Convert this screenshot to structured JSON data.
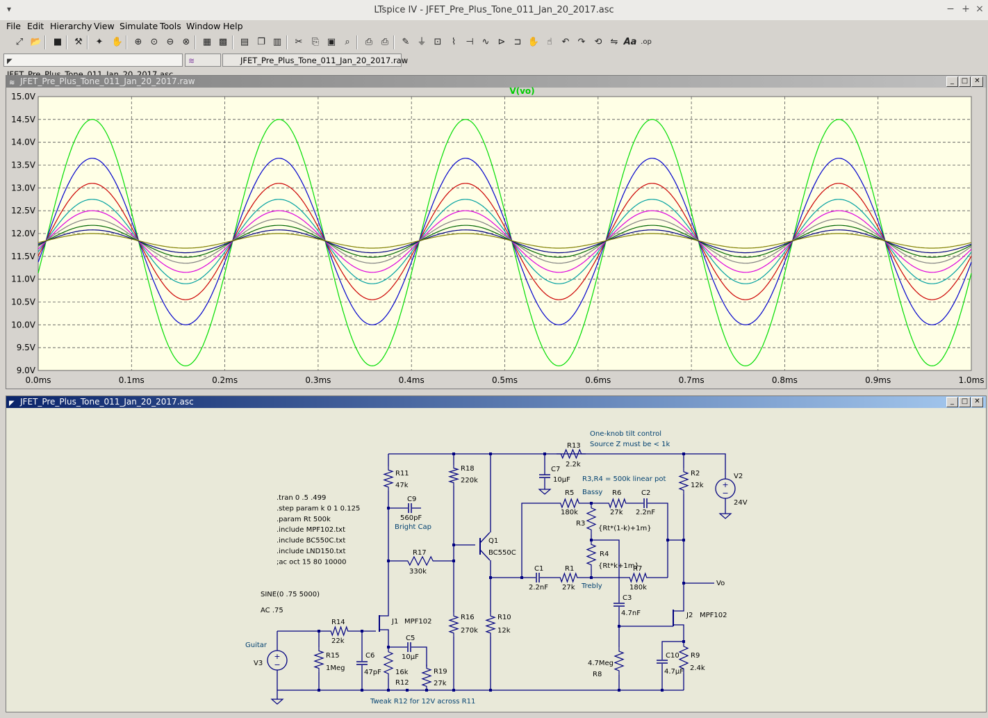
{
  "window": {
    "title": "LTspice IV - JFET_Pre_Plus_Tone_011_Jan_20_2017.asc",
    "menu_glyph": "▾"
  },
  "window_controls": {
    "minimize": "−",
    "maximize": "+",
    "close": "×"
  },
  "menu": [
    "File",
    "Edit",
    "Hierarchy",
    "View",
    "Simulate",
    "Tools",
    "Window",
    "Help"
  ],
  "toolbar_icons": [
    "new-schematic-icon",
    "open-icon",
    "save-icon",
    "control-panel-icon",
    "run-icon",
    "halt-icon",
    "zoom-in-icon",
    "zoom-full-icon",
    "zoom-out-icon",
    "zoom-cancel-icon",
    "autorange-icon",
    "grid-icon",
    "tile-horizontal-icon",
    "cascade-icon",
    "tile-vertical-icon",
    "cut-icon",
    "copy-icon",
    "paste-icon",
    "find-icon",
    "print-preview-icon",
    "print-icon",
    "draw-wire-icon",
    "ground-icon",
    "label-net-icon",
    "resistor-icon",
    "capacitor-icon",
    "inductor-icon",
    "diode-icon",
    "component-icon",
    "move-icon",
    "drag-icon",
    "undo-icon",
    "redo-icon",
    "rotate-icon",
    "mirror-icon",
    "text-icon",
    "spice-directive-icon"
  ],
  "toolbar_labels": {
    "text": "Aa",
    "directive": ".op"
  },
  "tabs": [
    {
      "label": "JFET_Pre_Plus_Tone_011_Jan_20_2017.asc",
      "icon": "schematic-tab-icon"
    },
    {
      "label": "",
      "icon": "waveform-tab-icon"
    },
    {
      "label": "JFET_Pre_Plus_Tone_011_Jan_20_2017.raw",
      "icon": ""
    }
  ],
  "waveform_window": {
    "title": "JFET_Pre_Plus_Tone_011_Jan_20_2017.raw",
    "trace_label": "V(vo)",
    "trace_label_color": "#00cc00"
  },
  "schematic_window": {
    "title": "JFET_Pre_Plus_Tone_011_Jan_20_2017.asc"
  },
  "chart_data": {
    "type": "line",
    "title": "V(vo)",
    "xlabel": "",
    "ylabel": "",
    "x_ticks": [
      "0.0ms",
      "0.1ms",
      "0.2ms",
      "0.3ms",
      "0.4ms",
      "0.5ms",
      "0.6ms",
      "0.7ms",
      "0.8ms",
      "0.9ms",
      "1.0ms"
    ],
    "y_ticks": [
      "15.0V",
      "14.5V",
      "14.0V",
      "13.5V",
      "13.0V",
      "12.5V",
      "12.0V",
      "11.5V",
      "11.0V",
      "10.5V",
      "10.0V",
      "9.5V",
      "9.0V"
    ],
    "xlim": [
      0,
      1.0
    ],
    "ylim": [
      9.0,
      15.0
    ],
    "grid": true,
    "background": "#ffffe6",
    "period_ms": 0.2,
    "series": [
      {
        "color": "#00dd00",
        "max": 14.5,
        "min": 9.1
      },
      {
        "color": "#0000cc",
        "max": 13.65,
        "min": 10.0
      },
      {
        "color": "#cc0000",
        "max": 13.1,
        "min": 10.55
      },
      {
        "color": "#00a0a0",
        "max": 12.75,
        "min": 10.9
      },
      {
        "color": "#dd00dd",
        "max": 12.5,
        "min": 11.15
      },
      {
        "color": "#808080",
        "max": 12.32,
        "min": 11.35
      },
      {
        "color": "#006600",
        "max": 12.18,
        "min": 11.48
      },
      {
        "color": "#000080",
        "max": 12.08,
        "min": 11.58
      },
      {
        "color": "#808000",
        "max": 12.0,
        "min": 11.68
      }
    ]
  },
  "schematic_text": {
    "directives": [
      ".tran 0 .5 .499",
      ".step param k 0 1 0.125",
      ".param Rt 500k",
      ".include MPF102.txt",
      ".include BC550C.txt",
      ".include LND150.txt",
      ";ac oct 15 80 10000"
    ],
    "source": [
      "SINE(0 .75 5000)",
      "AC .75"
    ],
    "comments": {
      "tilt1": "One-knob tilt control",
      "tilt2": "Source Z must be < 1k",
      "pot": "R3,R4 = 500k linear pot",
      "bassy": "Bassy",
      "trebly": "Trebly",
      "bright": "Bright Cap",
      "guitar": "Guitar",
      "tweak": "Tweak R12 for 12V across R11"
    },
    "labels": {
      "R13": "R13",
      "R13v": "2.2k",
      "C7": "C7",
      "C7v": "10µF",
      "R11": "R11",
      "R11v": "47k",
      "R18": "R18",
      "R18v": "220k",
      "R2": "R2",
      "R2v": "12k",
      "V2": "V2",
      "V2v": "24V",
      "C9": "C9",
      "C9v": "560pF",
      "R5": "R5",
      "R5v": "180k",
      "R6": "R6",
      "R6v": "27k",
      "C2": "C2",
      "C2v": "2.2nF",
      "R3": "R3",
      "R3v": "{Rt*(1-k)+1m}",
      "Q1": "Q1",
      "Q1v": "BC550C",
      "R4": "R4",
      "R4v": "{Rt*k+1m}",
      "R7": "R7",
      "R7v": "180k",
      "R17": "R17",
      "R17v": "330k",
      "C1": "C1",
      "C1v": "2.2nF",
      "R1": "R1",
      "R1v": "27k",
      "Vo": "Vo",
      "C3": "C3",
      "C3v": "4.7nF",
      "J1": "J1",
      "J1v": "MPF102",
      "J2": "J2",
      "J2v": "MPF102",
      "R16": "R16",
      "R16v": "270k",
      "R10": "R10",
      "R10v": "12k",
      "R14": "R14",
      "R14v": "22k",
      "C5": "C5",
      "C5v": "10µF",
      "C6": "C6",
      "C6v": "47pF",
      "R15": "R15",
      "R15v": "1Meg",
      "V3": "V3",
      "R12": "R12",
      "R12v": "16k",
      "R19": "R19",
      "R19v": "27k",
      "R8": "R8",
      "R8v": "4.7Meg",
      "C10": "C10",
      "C10v": "4.7µF",
      "R9": "R9",
      "R9v": "2.4k"
    }
  }
}
